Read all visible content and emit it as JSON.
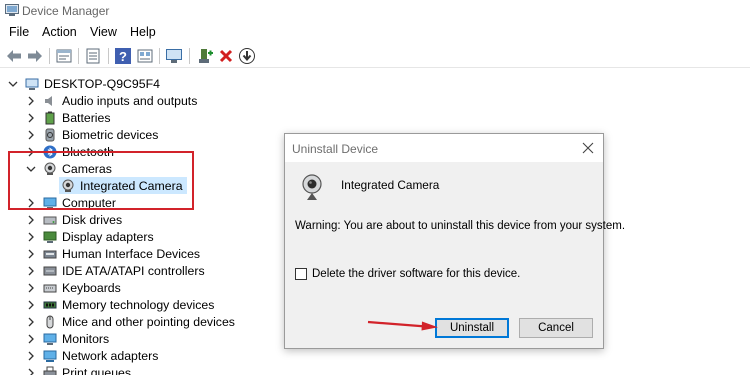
{
  "window": {
    "title": "Device Manager",
    "icon": "device-manager-icon"
  },
  "menu": {
    "items": [
      "File",
      "Action",
      "View",
      "Help"
    ]
  },
  "toolbar": {
    "buttons": [
      "back-arrow-icon",
      "forward-arrow-icon",
      "properties-icon",
      "list-icon",
      "help-icon",
      "resources-icon",
      "monitor-scan-icon",
      "add-driver-icon",
      "uninstall-x-icon",
      "update-driver-icon"
    ]
  },
  "tree": {
    "root": "DESKTOP-Q9C95F4",
    "items": [
      {
        "label": "Audio inputs and outputs",
        "icon": "speaker-icon",
        "expanded": false
      },
      {
        "label": "Batteries",
        "icon": "battery-icon",
        "expanded": false
      },
      {
        "label": "Biometric devices",
        "icon": "biometric-icon",
        "expanded": false
      },
      {
        "label": "Bluetooth",
        "icon": "bluetooth-icon",
        "expanded": false
      },
      {
        "label": "Cameras",
        "icon": "camera-icon",
        "expanded": true
      },
      {
        "label": "Integrated Camera",
        "icon": "camera-icon",
        "child": true,
        "selected": true
      },
      {
        "label": "Computer",
        "icon": "computer-icon",
        "expanded": false
      },
      {
        "label": "Disk drives",
        "icon": "disk-icon",
        "expanded": false
      },
      {
        "label": "Display adapters",
        "icon": "display-adapter-icon",
        "expanded": false
      },
      {
        "label": "Human Interface Devices",
        "icon": "hid-icon",
        "expanded": false
      },
      {
        "label": "IDE ATA/ATAPI controllers",
        "icon": "ide-icon",
        "expanded": false
      },
      {
        "label": "Keyboards",
        "icon": "keyboard-icon",
        "expanded": false
      },
      {
        "label": "Memory technology devices",
        "icon": "memory-icon",
        "expanded": false
      },
      {
        "label": "Mice and other pointing devices",
        "icon": "mouse-icon",
        "expanded": false
      },
      {
        "label": "Monitors",
        "icon": "monitor-icon",
        "expanded": false
      },
      {
        "label": "Network adapters",
        "icon": "network-icon",
        "expanded": false
      },
      {
        "label": "Print queues",
        "icon": "printer-icon",
        "expanded": false
      }
    ]
  },
  "dialog": {
    "title": "Uninstall Device",
    "device_name": "Integrated Camera",
    "warning": "Warning: You are about to uninstall this device from your system.",
    "checkbox_label": "Delete the driver software for this device.",
    "checkbox_checked": false,
    "uninstall_label": "Uninstall",
    "cancel_label": "Cancel"
  },
  "colors": {
    "highlight_box": "#d2232a",
    "annotation_arrow": "#d2232a",
    "selection": "#cce8ff",
    "accent": "#0078d7"
  }
}
